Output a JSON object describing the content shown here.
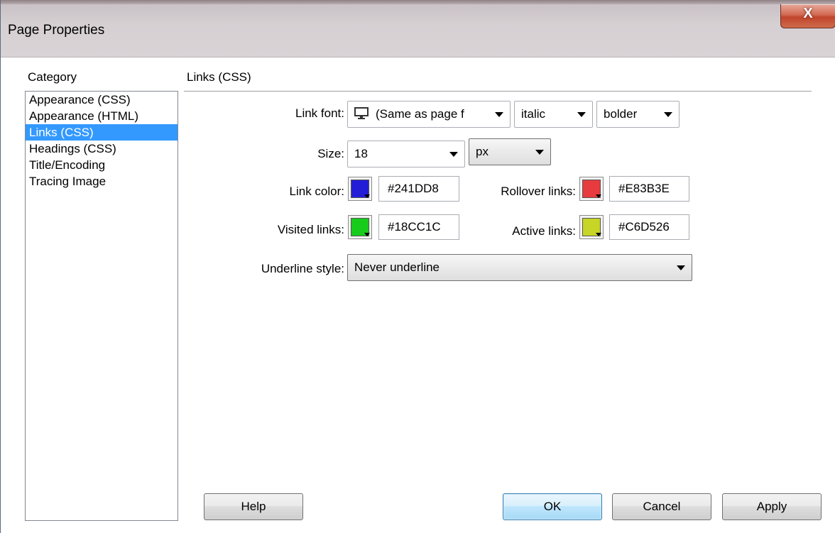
{
  "window": {
    "title": "Page Properties",
    "close_label": "X"
  },
  "category": {
    "label": "Category",
    "items": [
      "Appearance (CSS)",
      "Appearance (HTML)",
      "Links (CSS)",
      "Headings (CSS)",
      "Title/Encoding",
      "Tracing Image"
    ],
    "selected": "Links (CSS)"
  },
  "section": {
    "title": "Links (CSS)"
  },
  "link_font": {
    "label": "Link font:",
    "value": "(Same as page f",
    "icon": "monitor-icon"
  },
  "font_style": {
    "value": "italic"
  },
  "font_weight": {
    "value": "bolder"
  },
  "size": {
    "label": "Size:",
    "value": "18",
    "unit": "px"
  },
  "link_color": {
    "label": "Link color:",
    "hex": "#241DD8",
    "color": "#241DD8"
  },
  "rollover_links": {
    "label": "Rollover links:",
    "hex": "#E83B3E",
    "color": "#E83B3E"
  },
  "visited_links": {
    "label": "Visited links:",
    "hex": "#18CC1C",
    "color": "#18CC1C"
  },
  "active_links": {
    "label": "Active links:",
    "hex": "#C6D526",
    "color": "#C6D526"
  },
  "underline_style": {
    "label": "Underline style:",
    "value": "Never underline"
  },
  "buttons": {
    "help": "Help",
    "ok": "OK",
    "cancel": "Cancel",
    "apply": "Apply"
  }
}
